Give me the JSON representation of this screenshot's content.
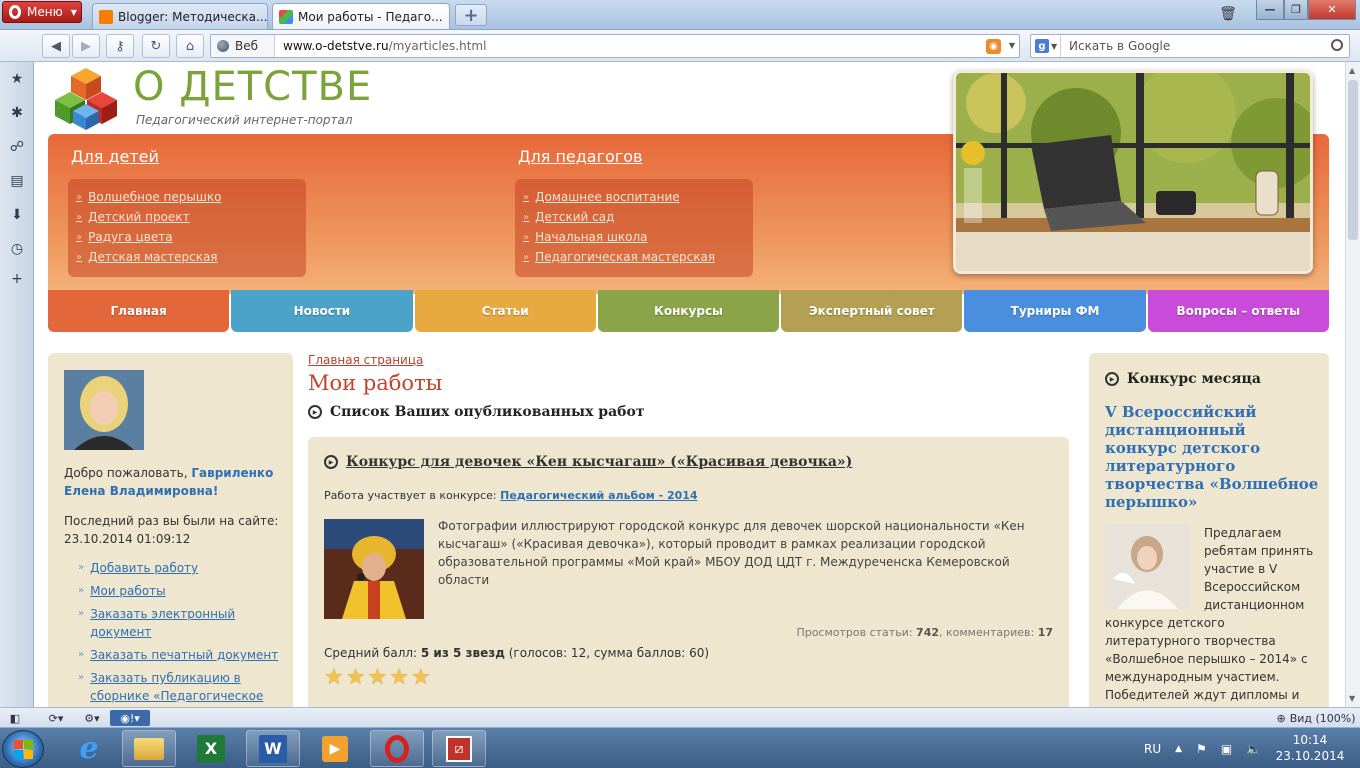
{
  "browser": {
    "menu_label": "Меню",
    "tabs": [
      {
        "label": "Blogger: Методическа...",
        "active": false
      },
      {
        "label": "Мои работы - Педаго...",
        "active": true
      }
    ],
    "address": {
      "mode_label": "Веб",
      "url_host": "www.o-detstve.ru",
      "url_path": "/myarticles.html"
    },
    "search": {
      "engine": "Google",
      "placeholder": "Искать в Google"
    },
    "statusbar": {
      "zoom_label": "Вид (100%)"
    }
  },
  "site": {
    "logo_title": "О ДЕТСТВЕ",
    "logo_subtitle": "Педагогический интернет-портал",
    "children_section": {
      "title": "Для детей",
      "links": [
        "Волшебное перышко",
        "Детский проект",
        "Радуга цвета",
        "Детская мастерская"
      ]
    },
    "teachers_section": {
      "title": "Для педагогов",
      "links": [
        "Домашнее воспитание",
        "Детский сад",
        "Начальная школа",
        "Педагогическая мастерская"
      ]
    },
    "nav": [
      {
        "label": "Главная",
        "color": "#e2673b"
      },
      {
        "label": "Новости",
        "color": "#4ba3c9"
      },
      {
        "label": "Статьи",
        "color": "#e8a940"
      },
      {
        "label": "Конкурсы",
        "color": "#8aa447"
      },
      {
        "label": "Экспертный совет",
        "color": "#b4a052"
      },
      {
        "label": "Турниры ФМ",
        "color": "#4a8fde"
      },
      {
        "label": "Вопросы – ответы",
        "color": "#c94bd9"
      }
    ]
  },
  "sidebar_left": {
    "welcome_prefix": "Добро пожаловать, ",
    "user_name": "Гавриленко Елена Владимировна!",
    "last_visit_label": "Последний раз вы были на сайте:",
    "last_visit_value": "23.10.2014 01:09:12",
    "menu": [
      "Добавить работу",
      "Мои работы",
      "Заказать электронный документ",
      "Заказать печатный документ",
      "Заказать публикацию в сборнике «Педагогическое"
    ]
  },
  "main": {
    "breadcrumb": "Главная страница",
    "title": "Мои работы",
    "subtitle": "Список Ваших опубликованных работ",
    "article": {
      "title": "Конкурс для девочек «Кен кысчагаш» («Красивая девочка»)",
      "contest_label": "Работа участвует в конкурсе:",
      "contest_name": "Педагогический альбом - 2014",
      "description": "Фотографии иллюстрируют городской конкурс для девочек шорской национальности «Кен кысчагаш» («Красивая девочка»), который проводит в рамках реализации городской образовательной программы «Мой край» МБОУ ДОД ЦДТ г. Междуреченска Кемеровской области",
      "views_label": "Просмотров статьи:",
      "views": "742",
      "comments_label": ", комментариев:",
      "comments": "17",
      "score_label": "Средний балл:",
      "score_value": "5 из 5 звезд",
      "score_details": "(голосов: 12, сумма баллов: 60)",
      "rating_stars": 5
    }
  },
  "sidebar_right": {
    "heading": "Конкурс месяца",
    "contest_title": "V Всероссийский дистанционный конкурс детского литературного творчества «Волшебное перышко»",
    "contest_text": "Предлагаем ребятам принять участие в V Всероссийском дистанционном конкурсе детского литературного творчества «Волшебное перышко – 2014» с международным участием. Победителей ждут дипломы и"
  },
  "taskbar": {
    "lang": "RU",
    "time": "10:14",
    "date": "23.10.2014"
  }
}
